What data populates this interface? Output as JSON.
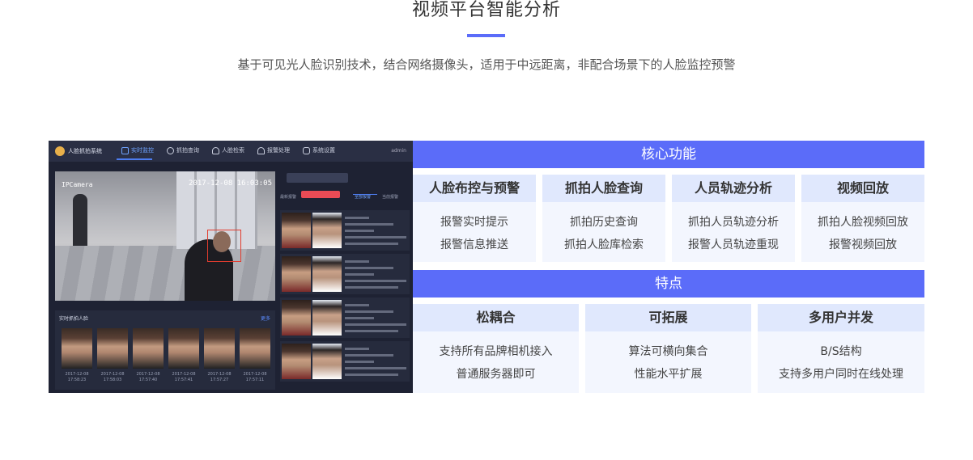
{
  "header": {
    "title": "视频平台智能分析",
    "subtitle": "基于可见光人脸识别技术，结合网络摄像头，适用于中远距离，非配合场景下的人脸监控预警"
  },
  "screenshot": {
    "app_name": "人脸抓拍系统",
    "nav": [
      "实时监控",
      "抓拍查询",
      "人脸检索",
      "报警处理",
      "系统设置"
    ],
    "user": "admin",
    "camera_label": "IPCamera",
    "camera_time": "2017-12-08 16:03:05",
    "capture_title": "实时抓拍人脸",
    "capture_more": "更多",
    "capture_dates": [
      "2017-12-08 17:58:23",
      "2017-12-08 17:58:03",
      "2017-12-08 17:57:40",
      "2017-12-08 17:57:41",
      "2017-12-08 17:57:27",
      "2017-12-08 17:57:11"
    ],
    "side_tabs": [
      "最新报警",
      "全部报警",
      "当前报警"
    ]
  },
  "core": {
    "title": "核心功能",
    "items": [
      {
        "name": "人脸布控与预警",
        "lines": [
          "报警实时提示",
          "报警信息推送"
        ]
      },
      {
        "name": "抓拍人脸查询",
        "lines": [
          "抓拍历史查询",
          "抓拍人脸库检索"
        ]
      },
      {
        "name": "人员轨迹分析",
        "lines": [
          "抓拍人员轨迹分析",
          "报警人员轨迹重现"
        ]
      },
      {
        "name": "视频回放",
        "lines": [
          "抓拍人脸视频回放",
          "报警视频回放"
        ]
      }
    ]
  },
  "features": {
    "title": "特点",
    "items": [
      {
        "name": "松耦合",
        "lines": [
          "支持所有品牌相机接入",
          "普通服务器即可"
        ]
      },
      {
        "name": "可拓展",
        "lines": [
          "算法可横向集合",
          "性能水平扩展"
        ]
      },
      {
        "name": "多用户并发",
        "lines": [
          "B/S结构",
          "支持多用户同时在线处理"
        ]
      }
    ]
  },
  "colors": {
    "accent": "#5b6cf9",
    "card_head": "#e0e8fd",
    "card_body": "#f3f6fe"
  }
}
